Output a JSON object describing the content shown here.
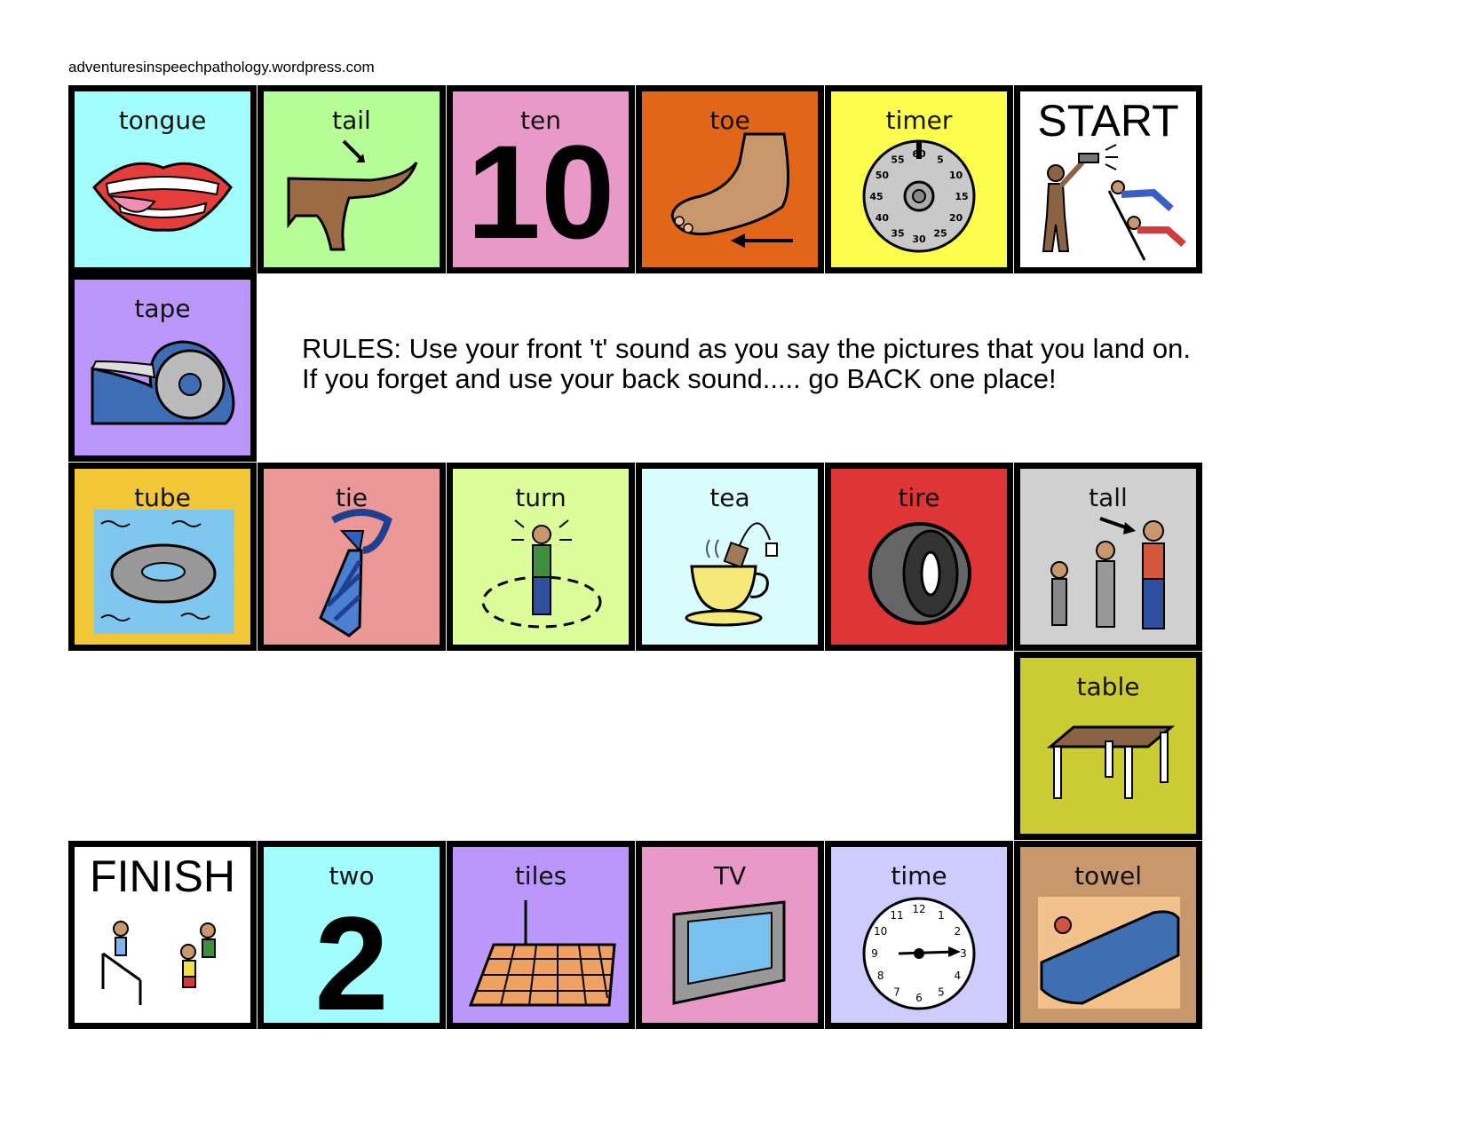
{
  "source": "adventuresinspeechpathology.wordpress.com",
  "rules": {
    "line1": "RULES: Use your front 't' sound as you say the pictures that you land on.",
    "line2": "If you forget and use your back sound..... go BACK one place!"
  },
  "tiles": {
    "tongue": {
      "label": "tongue",
      "color": "#a2fdfd"
    },
    "tail": {
      "label": "tail",
      "color": "#b7fd97"
    },
    "ten": {
      "label": "ten",
      "numeral": "10",
      "color": "#e899c7"
    },
    "toe": {
      "label": "toe",
      "color": "#e2661a"
    },
    "timer": {
      "label": "timer",
      "color": "#fdfd4d",
      "dial": [
        "60",
        "5",
        "10",
        "15",
        "20",
        "25",
        "30",
        "35",
        "40",
        "45",
        "50",
        "55"
      ]
    },
    "start": {
      "label": "START",
      "color": "#ffffff"
    },
    "tape": {
      "label": "tape",
      "color": "#bb97fb"
    },
    "tube": {
      "label": "tube",
      "color": "#f2c737"
    },
    "tie": {
      "label": "tie",
      "color": "#e99797"
    },
    "turn": {
      "label": "turn",
      "color": "#ddfd9a"
    },
    "tea": {
      "label": "tea",
      "color": "#d9fdfd"
    },
    "tire": {
      "label": "tire",
      "color": "#de3537"
    },
    "tall": {
      "label": "tall",
      "color": "#d0d0d0"
    },
    "table": {
      "label": "table",
      "color": "#cbcc33"
    },
    "finish": {
      "label": "FINISH",
      "color": "#ffffff"
    },
    "two": {
      "label": "two",
      "numeral": "2",
      "color": "#a2fdfd"
    },
    "tiles": {
      "label": "tiles",
      "color": "#bb97fb"
    },
    "tv": {
      "label": "TV",
      "color": "#e899c7"
    },
    "time": {
      "label": "time",
      "color": "#cdccfd",
      "dial": [
        "12",
        "1",
        "2",
        "3",
        "4",
        "5",
        "6",
        "7",
        "8",
        "9",
        "10",
        "11"
      ]
    },
    "towel": {
      "label": "towel",
      "color": "#c7986d"
    }
  }
}
